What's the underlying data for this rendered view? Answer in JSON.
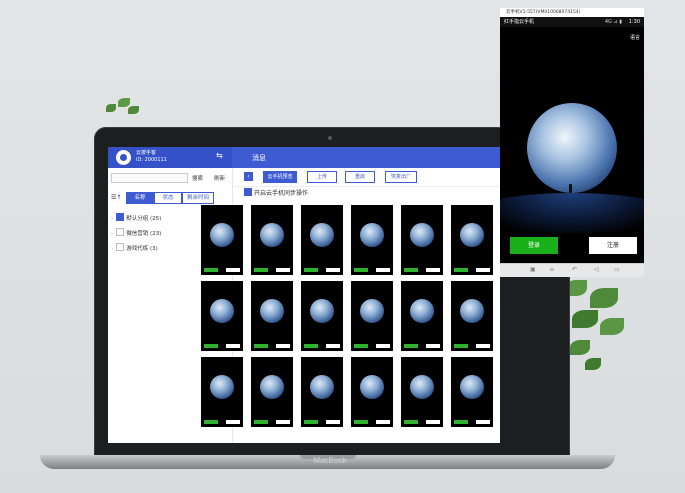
{
  "laptop": {
    "brand": "MacBook"
  },
  "app": {
    "profile_name": "云按手客",
    "profile_id": "ID: 2000111",
    "header_title": "消息",
    "search_label": "搜索",
    "refresh_label": "刷新",
    "sort_icon": "sort-icon",
    "tabs": [
      {
        "label": "名称",
        "active": true
      },
      {
        "label": "状态",
        "active": false
      },
      {
        "label": "剩余时间",
        "active": false
      }
    ],
    "groups": [
      {
        "label": "默认分组",
        "count": "(25)",
        "checked": true
      },
      {
        "label": "微信营销",
        "count": "(23)",
        "checked": false
      },
      {
        "label": "游戏代练",
        "count": "(3)",
        "checked": false
      }
    ],
    "toolbar": [
      {
        "label": "云手机预览",
        "active": true
      },
      {
        "label": "上传",
        "active": false
      },
      {
        "label": "重启",
        "active": false
      },
      {
        "label": "恢复出厂",
        "active": false
      }
    ],
    "sync_label": "开启云手机同步操作",
    "sync_checked": true
  },
  "phone": {
    "window_title": "云手机V1-557(VM010068074154)",
    "app_name": "红手指云手机",
    "time": "1:30",
    "signal": "4G ⊿ ▮",
    "language": "语言",
    "login": "登录",
    "register": "注册"
  },
  "colors": {
    "accent": "#3f5bd1",
    "green": "#19b019"
  }
}
